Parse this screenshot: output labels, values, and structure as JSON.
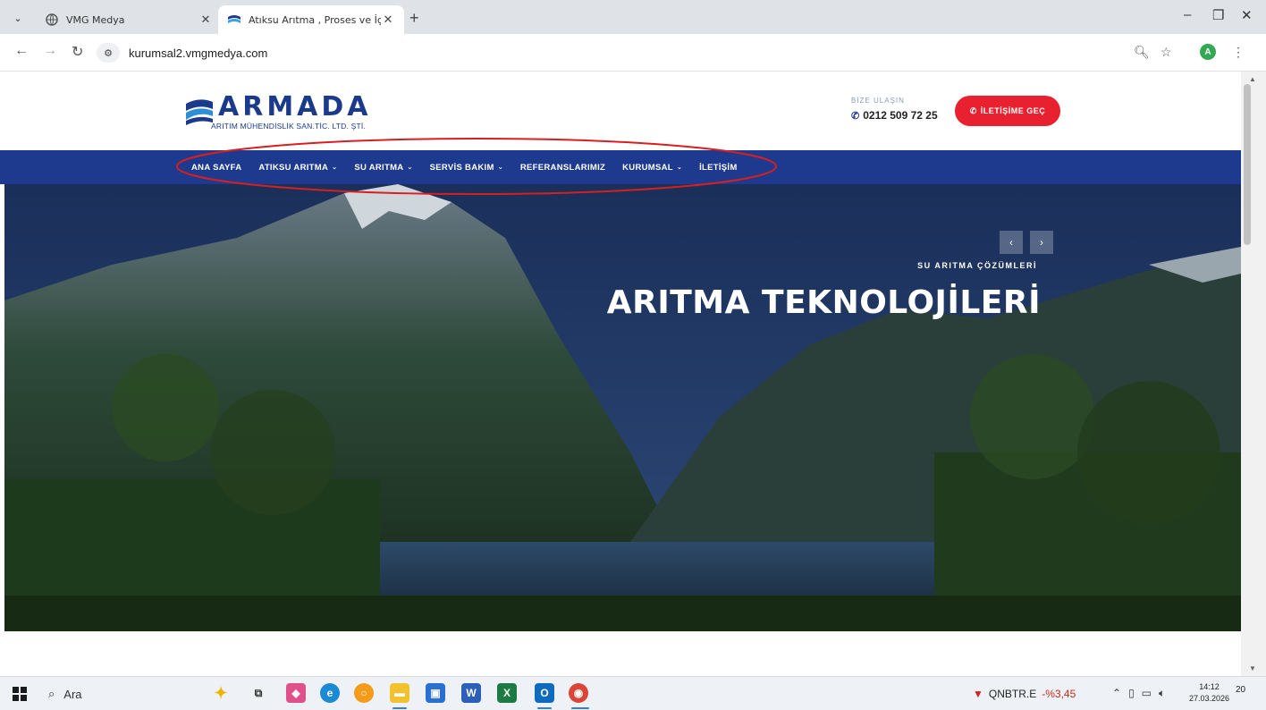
{
  "browser": {
    "tabs": [
      {
        "title": "VMG Medya",
        "active": false
      },
      {
        "title": "Atıksu Arıtma , Proses ve İçme S",
        "active": true
      }
    ],
    "new_tab_label": "+",
    "url": "kurumsal2.vmgmedya.com",
    "profile_initial": "A"
  },
  "site": {
    "logo": {
      "wordmark": "ARMADA",
      "subtitle": "ARITIM MÜHENDİSLİK SAN.TİC. LTD. ŞTİ."
    },
    "contact": {
      "label": "BİZE ULAŞIN",
      "phone": "0212 509 72 25",
      "cta_label": "İLETİŞİME GEÇ"
    },
    "nav": [
      {
        "label": "ANA SAYFA",
        "has_dropdown": false
      },
      {
        "label": "ATIKSU ARITMA",
        "has_dropdown": true
      },
      {
        "label": "SU ARITMA",
        "has_dropdown": true
      },
      {
        "label": "SERVİS BAKIM",
        "has_dropdown": true
      },
      {
        "label": "REFERANSLARIMIZ",
        "has_dropdown": false
      },
      {
        "label": "KURUMSAL",
        "has_dropdown": true
      },
      {
        "label": "İLETİŞİM",
        "has_dropdown": false
      }
    ],
    "hero": {
      "eyebrow": "SU ARITMA ÇÖZÜMLERİ",
      "title": "ARITMA TEKNOLOJİLERİ",
      "prev_label": "‹",
      "next_label": "›"
    },
    "colors": {
      "brand_blue": "#1e3a8f",
      "cta_red": "#e8202f",
      "annotation_red": "#d61f1f"
    }
  },
  "taskbar": {
    "search_label": "Ara",
    "stock": {
      "symbol": "QNBTR.E",
      "change": "-%3,45"
    },
    "time": "14:12",
    "date": "27.03.2026",
    "notification_count": "20"
  }
}
